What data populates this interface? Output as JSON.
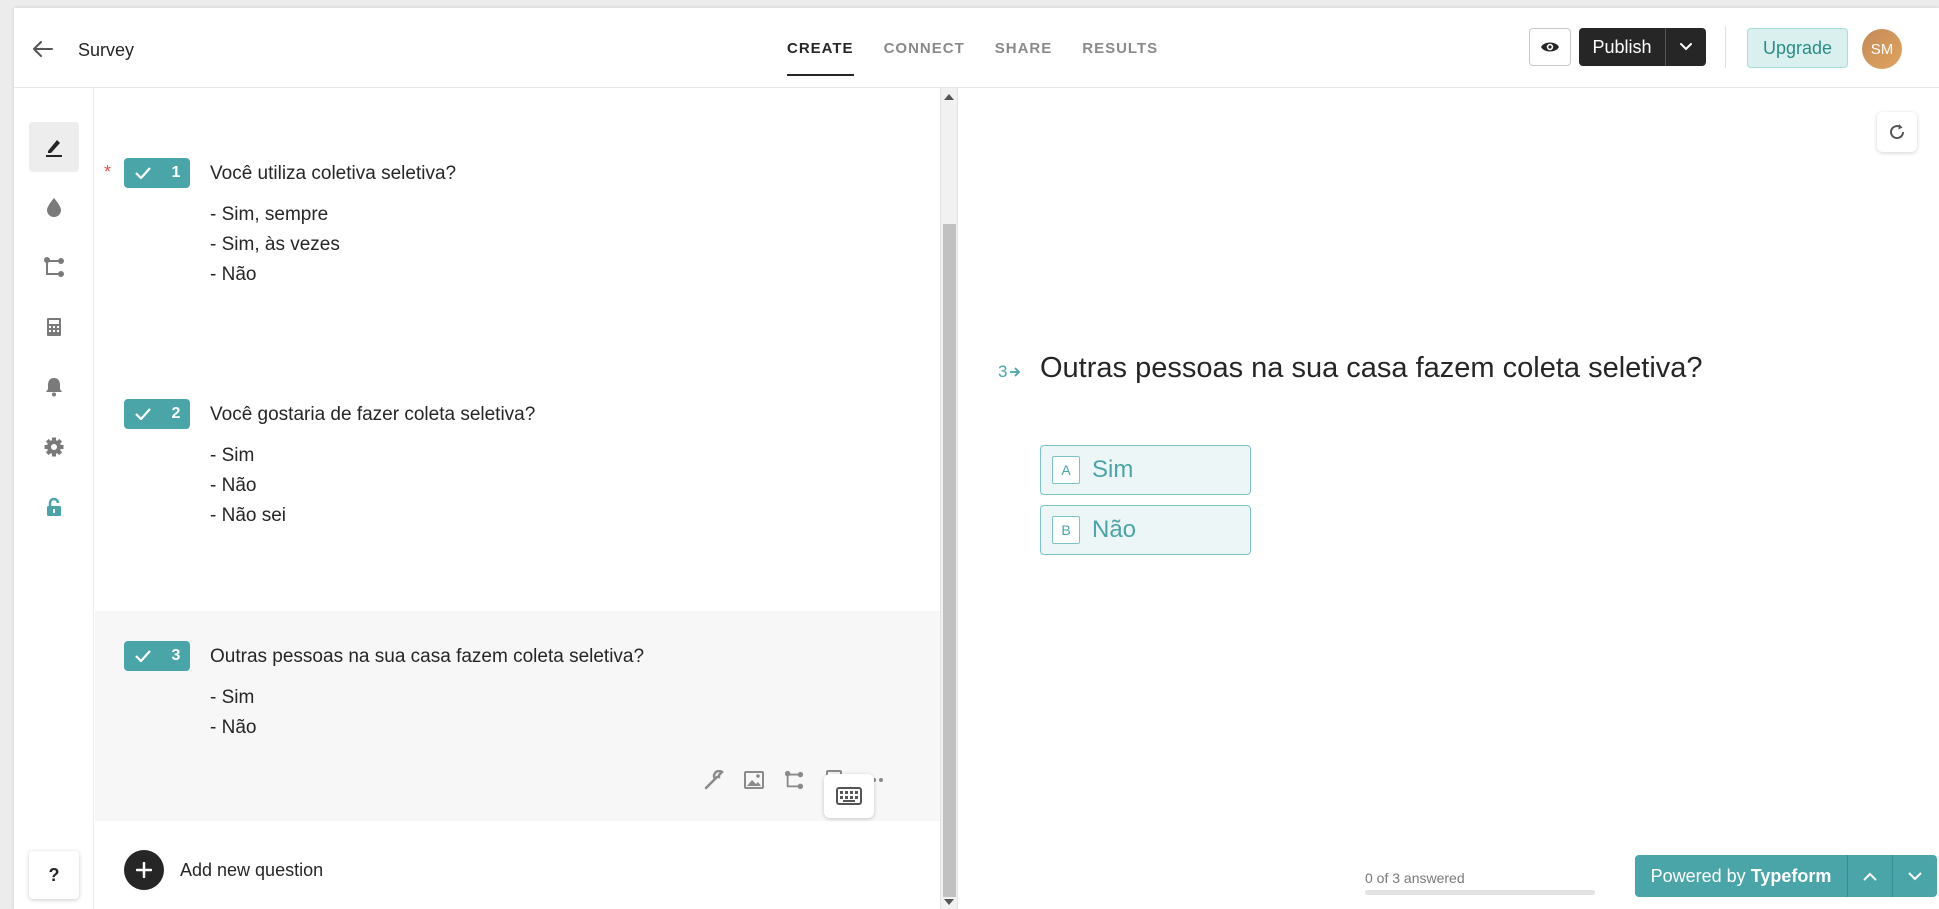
{
  "header": {
    "title": "Survey",
    "tabs": [
      {
        "label": "CREATE",
        "active": true
      },
      {
        "label": "CONNECT",
        "active": false
      },
      {
        "label": "SHARE",
        "active": false
      },
      {
        "label": "RESULTS",
        "active": false
      }
    ],
    "publish_label": "Publish",
    "upgrade_label": "Upgrade",
    "avatar_initials": "SM"
  },
  "sidebar": {
    "icons": [
      "edit-icon",
      "theme-drop-icon",
      "logic-branch-icon",
      "calculator-icon",
      "notification-bell-icon",
      "settings-gear-icon",
      "unlock-icon"
    ],
    "help_label": "?"
  },
  "questions": [
    {
      "number": "1",
      "required_mark": "*",
      "text": "Você utiliza coletiva seletiva?",
      "choices": [
        "- Sim, sempre",
        "- Sim, às vezes",
        "- Não"
      ]
    },
    {
      "number": "2",
      "text": "Você gostaria de fazer coleta seletiva?",
      "choices": [
        "- Sim",
        "- Não",
        "- Não sei"
      ]
    },
    {
      "number": "3",
      "text": "Outras pessoas na sua casa fazem coleta seletiva?",
      "choices": [
        "- Sim",
        "- Não"
      ],
      "selected": true
    }
  ],
  "question_tools": [
    "wrench-icon",
    "image-icon",
    "logic-branch-icon",
    "calculator-icon",
    "more-icon"
  ],
  "add_question_label": "Add new question",
  "preview": {
    "question_number": "3",
    "question_text": "Outras pessoas na sua casa fazem coleta seletiva?",
    "choices": [
      {
        "key": "A",
        "label": "Sim"
      },
      {
        "key": "B",
        "label": "Não"
      }
    ],
    "progress_text": "0 of 3 answered",
    "progress_fraction": 0,
    "powered_by_prefix": "Powered by",
    "powered_by_brand": "Typeform"
  },
  "colors": {
    "accent": "#4aa5a9",
    "dark": "#262627",
    "upgrade_bg": "#d9f0ef",
    "required": "#d9534f"
  }
}
